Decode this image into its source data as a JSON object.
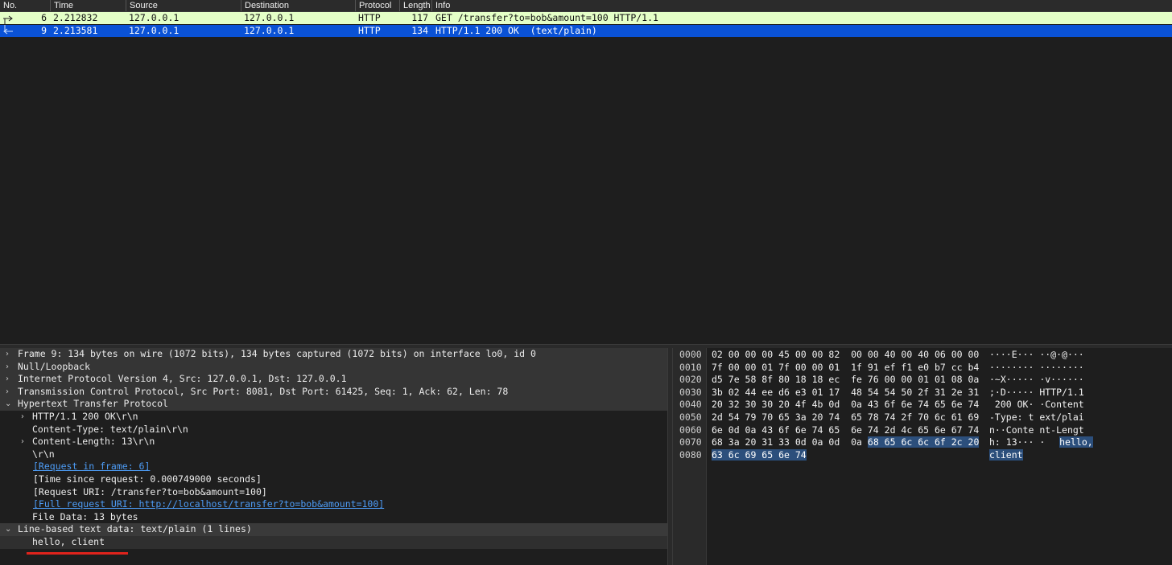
{
  "packet_list": {
    "columns": [
      "No.",
      "Time",
      "Source",
      "Destination",
      "Protocol",
      "Length",
      "Info"
    ],
    "rows": [
      {
        "no": "6",
        "time": "2.212832",
        "source": "127.0.0.1",
        "destination": "127.0.0.1",
        "protocol": "HTTP",
        "length": "117",
        "info": "GET /transfer?to=bob&amount=100 HTTP/1.1",
        "arrow": "request-arrow-icon"
      },
      {
        "no": "9",
        "time": "2.213581",
        "source": "127.0.0.1",
        "destination": "127.0.0.1",
        "protocol": "HTTP",
        "length": "134",
        "info": "HTTP/1.1 200 OK  (text/plain)",
        "arrow": "response-arrow-icon"
      }
    ],
    "colors": {
      "request_row": "#e4ffc7",
      "selected_row": "#0a52d6"
    }
  },
  "details": {
    "frame": "Frame 9: 134 bytes on wire (1072 bits), 134 bytes captured (1072 bits) on interface lo0, id 0",
    "null": "Null/Loopback",
    "ip": "Internet Protocol Version 4, Src: 127.0.0.1, Dst: 127.0.0.1",
    "tcp": "Transmission Control Protocol, Src Port: 8081, Dst Port: 61425, Seq: 1, Ack: 62, Len: 78",
    "http": "Hypertext Transfer Protocol",
    "http_status": "HTTP/1.1 200 OK\\r\\n",
    "content_type": "Content-Type: text/plain\\r\\n",
    "content_length": "Content-Length: 13\\r\\n",
    "crlf": "\\r\\n",
    "request_in_frame": "[Request in frame: 6]",
    "time_since_request": "[Time since request: 0.000749000 seconds]",
    "request_uri": "[Request URI: /transfer?to=bob&amount=100]",
    "full_request_uri": "[Full request URI: http://localhost/transfer?to=bob&amount=100]",
    "file_data": "File Data: 13 bytes",
    "line_based": "Line-based text data: text/plain (1 lines)",
    "body_text": "hello, client"
  },
  "hex": {
    "rows": [
      {
        "offset": "0000",
        "bytes_a": "02 00 00 00 45 00 00 82",
        "bytes_b": "00 00 40 00 40 06 00 00",
        "ascii_a": "····E···",
        "ascii_b": "··@·@···"
      },
      {
        "offset": "0010",
        "bytes_a": "7f 00 00 01 7f 00 00 01",
        "bytes_b": "1f 91 ef f1 e0 b7 cc b4",
        "ascii_a": "········",
        "ascii_b": "········"
      },
      {
        "offset": "0020",
        "bytes_a": "d5 7e 58 8f 80 18 18 ec",
        "bytes_b": "fe 76 00 00 01 01 08 0a",
        "ascii_a": "·~X·····",
        "ascii_b": "·v······"
      },
      {
        "offset": "0030",
        "bytes_a": "3b 02 44 ee d6 e3 01 17",
        "bytes_b": "48 54 54 50 2f 31 2e 31",
        "ascii_a": ";·D·····",
        "ascii_b": "HTTP/1.1"
      },
      {
        "offset": "0040",
        "bytes_a": "20 32 30 30 20 4f 4b 0d",
        "bytes_b": "0a 43 6f 6e 74 65 6e 74",
        "ascii_a": " 200 OK·",
        "ascii_b": "·Content"
      },
      {
        "offset": "0050",
        "bytes_a": "2d 54 79 70 65 3a 20 74",
        "bytes_b": "65 78 74 2f 70 6c 61 69",
        "ascii_a": "-Type: t",
        "ascii_b": "ext/plai"
      },
      {
        "offset": "0060",
        "bytes_a": "6e 0d 0a 43 6f 6e 74 65",
        "bytes_b": "6e 74 2d 4c 65 6e 67 74",
        "ascii_a": "n··Conte",
        "ascii_b": "nt-Lengt"
      },
      {
        "offset": "0070",
        "bytes_a": "68 3a 20 31 33 0d 0a 0d",
        "bytes_b": "0a",
        "bytes_b_hl": "68 65 6c 6c 6f 2c 20",
        "ascii_a": "h: 13···",
        "ascii_b": "·",
        "ascii_b_hl": "hello,"
      },
      {
        "offset": "0080",
        "bytes_a_hl": "63 6c 69 65 6e 74",
        "ascii_a_hl": "client"
      }
    ],
    "highlight_color": "#2c4f7c"
  }
}
